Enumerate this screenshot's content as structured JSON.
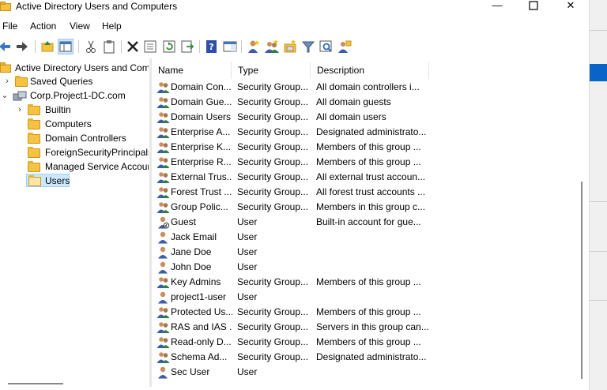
{
  "window": {
    "title": "Active Directory Users and Computers",
    "controls": {
      "minimize": "—",
      "maximize": "☐",
      "close": "✕"
    }
  },
  "menu": [
    "File",
    "Action",
    "View",
    "Help"
  ],
  "toolbar": {
    "icons": [
      "back-arrow-icon",
      "forward-arrow-icon",
      "up-folder-icon",
      "show-tree-icon",
      "cut-icon",
      "clipboard-icon",
      "delete-icon",
      "properties-icon",
      "refresh-icon",
      "export-list-icon",
      "help-icon",
      "console-pane-icon",
      "new-user-icon",
      "new-group-icon",
      "new-ou-icon",
      "filter-icon",
      "find-icon",
      "add-to-group-icon"
    ]
  },
  "tree": {
    "root": "Active Directory Users and Com",
    "items": [
      {
        "label": "Saved Queries",
        "expander": "›"
      },
      {
        "label": "Corp.Project1-DC.com",
        "expander": "⌄"
      },
      {
        "label": "Builtin",
        "expander": "›"
      },
      {
        "label": "Computers",
        "expander": ""
      },
      {
        "label": "Domain Controllers",
        "expander": ""
      },
      {
        "label": "ForeignSecurityPrincipals",
        "expander": ""
      },
      {
        "label": "Managed Service Accour",
        "expander": ""
      },
      {
        "label": "Users",
        "expander": ""
      }
    ]
  },
  "list": {
    "columns": [
      "Name",
      "Type",
      "Description"
    ],
    "rows": [
      {
        "name": "Domain Con...",
        "type": "Security Group...",
        "description": "All domain controllers i...",
        "icon": "group"
      },
      {
        "name": "Domain Gue...",
        "type": "Security Group...",
        "description": "All domain guests",
        "icon": "group"
      },
      {
        "name": "Domain Users",
        "type": "Security Group...",
        "description": "All domain users",
        "icon": "group"
      },
      {
        "name": "Enterprise A...",
        "type": "Security Group...",
        "description": "Designated administrato...",
        "icon": "group"
      },
      {
        "name": "Enterprise K...",
        "type": "Security Group...",
        "description": "Members of this group ...",
        "icon": "group"
      },
      {
        "name": "Enterprise R...",
        "type": "Security Group...",
        "description": "Members of this group ...",
        "icon": "group"
      },
      {
        "name": "External Trus...",
        "type": "Security Group...",
        "description": "All external trust accoun...",
        "icon": "group"
      },
      {
        "name": "Forest Trust ...",
        "type": "Security Group...",
        "description": "All forest trust accounts ...",
        "icon": "group"
      },
      {
        "name": "Group Polic...",
        "type": "Security Group...",
        "description": "Members in this group c...",
        "icon": "group"
      },
      {
        "name": "Guest",
        "type": "User",
        "description": "Built-in account for gue...",
        "icon": "user-disabled"
      },
      {
        "name": "Jack Email",
        "type": "User",
        "description": "",
        "icon": "user"
      },
      {
        "name": "Jane Doe",
        "type": "User",
        "description": "",
        "icon": "user"
      },
      {
        "name": "John Doe",
        "type": "User",
        "description": "",
        "icon": "user"
      },
      {
        "name": "Key Admins",
        "type": "Security Group...",
        "description": "Members of this group ...",
        "icon": "group"
      },
      {
        "name": "project1-user",
        "type": "User",
        "description": "",
        "icon": "user"
      },
      {
        "name": "Protected Us...",
        "type": "Security Group...",
        "description": "Members of this group ...",
        "icon": "group"
      },
      {
        "name": "RAS and IAS ...",
        "type": "Security Group...",
        "description": "Servers in this group can...",
        "icon": "group"
      },
      {
        "name": "Read-only D...",
        "type": "Security Group...",
        "description": "Members of this group ...",
        "icon": "group"
      },
      {
        "name": "Schema Ad...",
        "type": "Security Group...",
        "description": "Designated administrato...",
        "icon": "group"
      },
      {
        "name": "Sec User",
        "type": "User",
        "description": "",
        "icon": "user"
      }
    ]
  },
  "colors": {
    "selection": "#cce8ff",
    "action_pane_accent": "#0a64c8"
  }
}
